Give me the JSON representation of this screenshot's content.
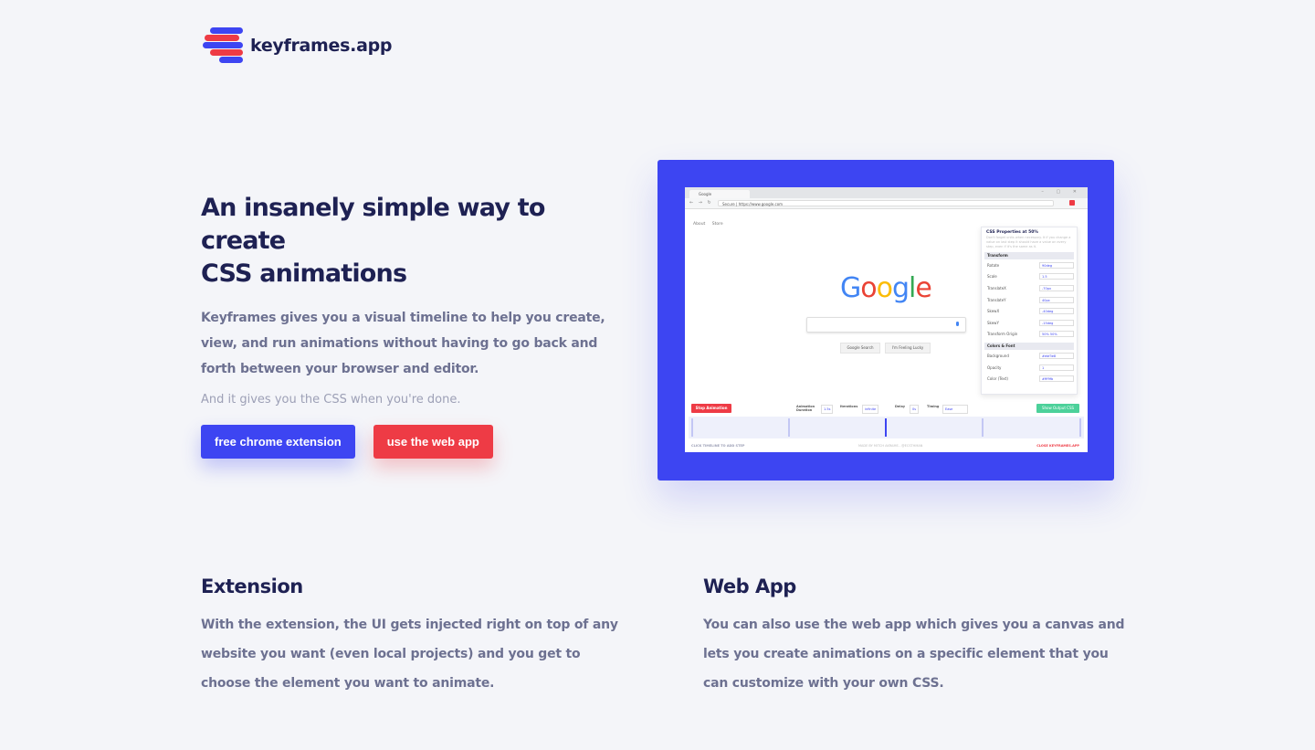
{
  "brand": {
    "name": "keyframes.app",
    "colors": {
      "blue": "#3d45f2",
      "red": "#ee3b45",
      "navy": "#1e2153",
      "text": "#6d7191",
      "muted": "#9da0b6",
      "background": "#f4f5f9"
    },
    "logo_icon": "stacked-bars-logo-icon"
  },
  "hero": {
    "title_line1": "An insanely simple way to create",
    "title_line2": "CSS animations",
    "description": "Keyframes gives you a visual timeline to help you create, view, and run animations without having to go back and forth between your browser and editor.",
    "subtext": "And it gives you the CSS when you're done.",
    "primary_button": "free chrome extension",
    "secondary_button": "use the web app"
  },
  "screenshot": {
    "tab_title": "Google",
    "url": "Secure | https://www.google.com",
    "nav_links": [
      "About",
      "Store"
    ],
    "google_logo": "Google",
    "search_buttons": [
      "Google Search",
      "I'm Feeling Lucky"
    ],
    "panel": {
      "title": "CSS Properties at 50%",
      "hint": "Don't forget units when necessary. It if you change a value on last step it should have a value on every step, even if it's the same as it.",
      "sections": [
        {
          "name": "Transform",
          "rows": [
            {
              "label": "Rotate",
              "value": "90deg"
            },
            {
              "label": "Scale",
              "value": "1.5"
            },
            {
              "label": "TranslateX",
              "value": "-70px"
            },
            {
              "label": "TranslateY",
              "value": "40px"
            },
            {
              "label": "SkewX",
              "value": "-40deg"
            },
            {
              "label": "SkewY",
              "value": "-15deg"
            },
            {
              "label": "Transform Origin",
              "value": "50% 50%"
            }
          ]
        },
        {
          "name": "Colors & Font",
          "rows": [
            {
              "label": "Background",
              "value": "#ebf3e8"
            },
            {
              "label": "Opacity",
              "value": "1"
            },
            {
              "label": "Color (Text)",
              "value": "#fff9fb"
            }
          ]
        }
      ]
    },
    "controls": {
      "stop_button": "Stop Animation",
      "duration_label": "Animation Duration",
      "duration_value": "1.5s",
      "iterations_label": "Iterations",
      "iterations_value": "infinite",
      "delay_label": "Delay",
      "delay_value": "0s",
      "timing_label": "Timing",
      "timing_value": "Ease",
      "output_button": "Show Output CSS"
    },
    "footer": {
      "left": "CLICK TIMELINE TO ADD STEP",
      "middle": "MADE BY MITCH AKRAMS - @ECSTHMAN",
      "right": "CLOSE KEYFRAMES.APP"
    }
  },
  "features": [
    {
      "title": "Extension",
      "text": "With the extension, the UI gets injected right on top of any website you want (even local projects) and you get to choose the element you want to animate."
    },
    {
      "title": "Web App",
      "text": "You can also use the web app which gives you a canvas and lets you create animations on a specific element that you can customize with your own CSS."
    }
  ]
}
